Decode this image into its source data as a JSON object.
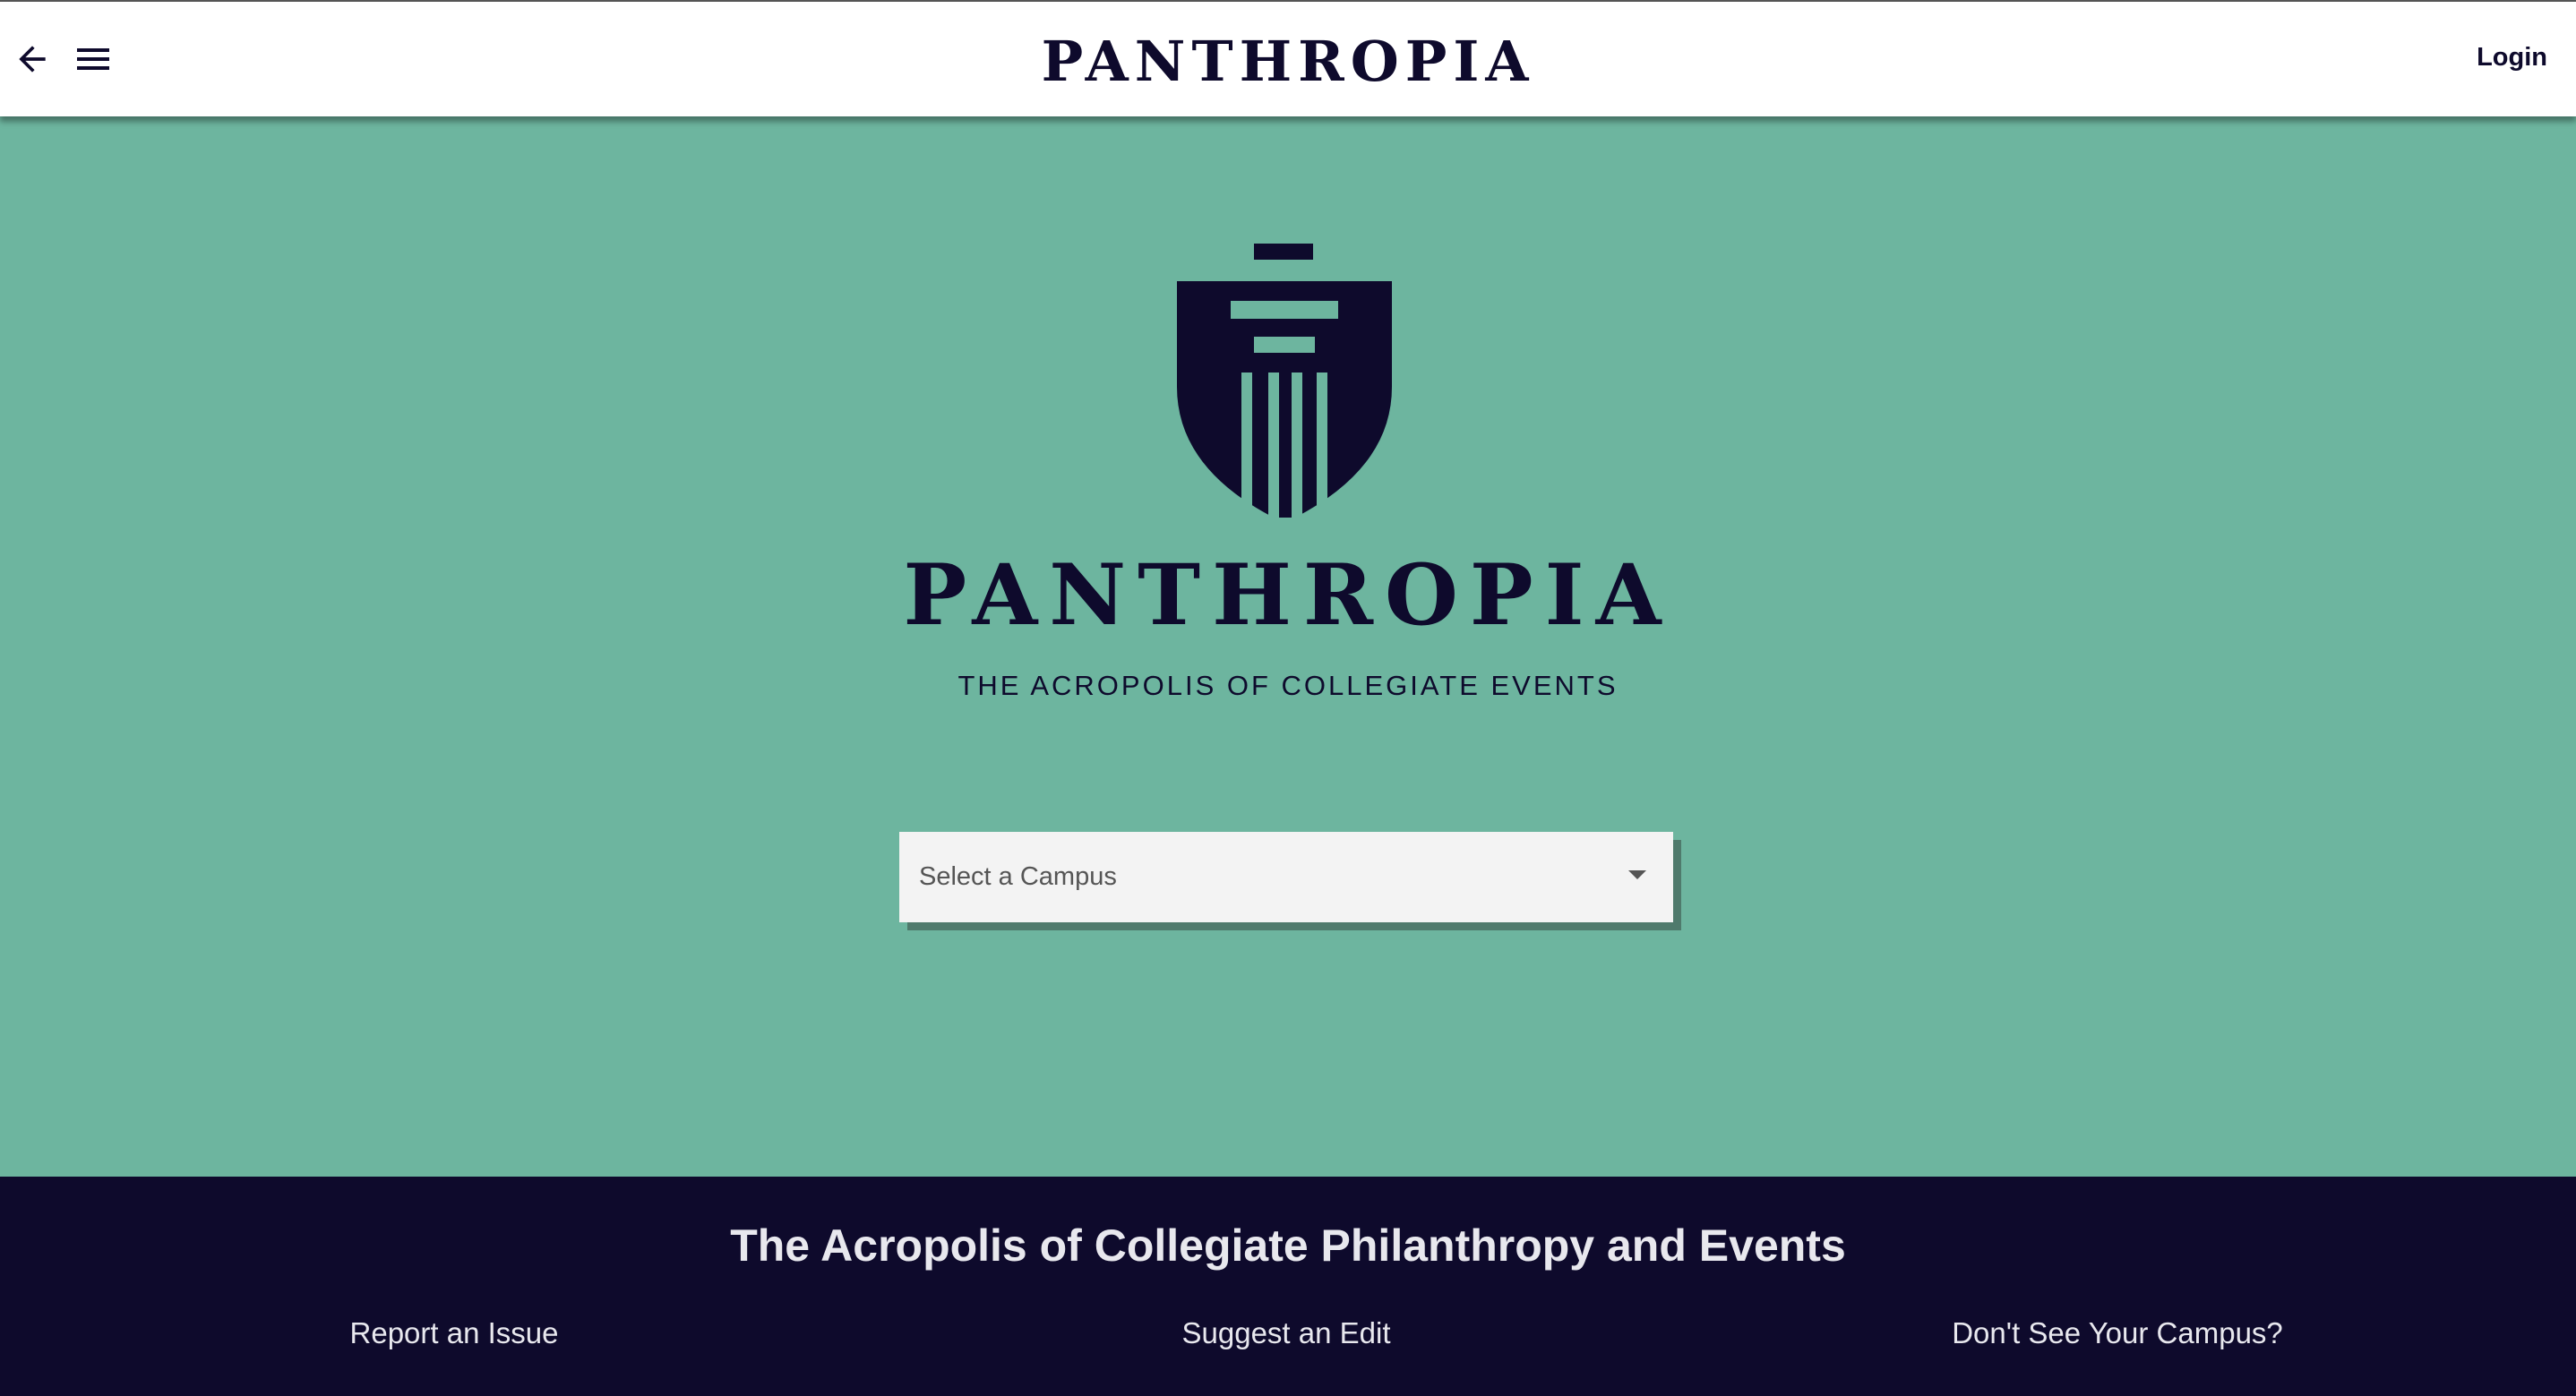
{
  "header": {
    "brand": "PANTHROPIA",
    "login_label": "Login",
    "back_icon": "arrow-left-icon",
    "menu_icon": "hamburger-menu-icon"
  },
  "hero": {
    "logo_icon": "column-shield-logo",
    "logo_word": "PANTHROPIA",
    "tagline": "THE ACROPOLIS OF COLLEGIATE EVENTS"
  },
  "campus_select": {
    "placeholder": "Select a Campus",
    "caret_icon": "caret-down-icon"
  },
  "footer": {
    "title": "The Acropolis of Collegiate Philanthropy and Events",
    "links": [
      "Report an Issue",
      "Suggest an Edit",
      "Don't See Your Campus?"
    ]
  },
  "colors": {
    "brand_navy": "#0e0a2c",
    "hero_green": "#6db59f",
    "header_bg": "#ffffff",
    "select_bg": "#f3f3f3",
    "footer_text": "#e8e8ee"
  }
}
